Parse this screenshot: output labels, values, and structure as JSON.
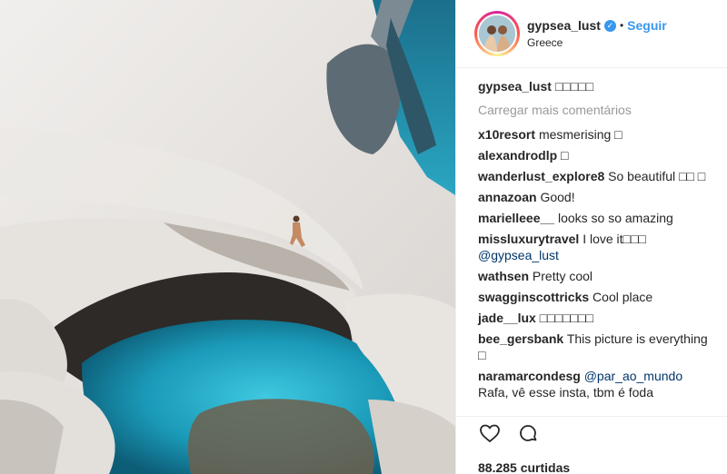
{
  "post": {
    "username": "gypsea_lust",
    "verified_symbol": "✓",
    "separator": "•",
    "follow_label": "Seguir",
    "location": "Greece",
    "likes": "88.285 curtidas"
  },
  "caption": {
    "author": "gypsea_lust",
    "text": "□□□□□"
  },
  "load_more_label": "Carregar mais comentários",
  "comments": [
    {
      "author": "x10resort",
      "text": "mesmerising □",
      "mention": "",
      "suffix": ""
    },
    {
      "author": "alexandrodlp",
      "text": "□",
      "mention": "",
      "suffix": ""
    },
    {
      "author": "wanderlust_explore8",
      "text": "So beautiful □□ □",
      "mention": "",
      "suffix": ""
    },
    {
      "author": "annazoan",
      "text": "Good!",
      "mention": "",
      "suffix": ""
    },
    {
      "author": "marielleee__",
      "text": "looks so so amazing",
      "mention": "",
      "suffix": ""
    },
    {
      "author": "missluxurytravel",
      "text": "I love it□□□ ",
      "mention": "@gypsea_lust",
      "suffix": ""
    },
    {
      "author": "wathsen",
      "text": "Pretty cool",
      "mention": "",
      "suffix": ""
    },
    {
      "author": "swagginscottricks",
      "text": "Cool place",
      "mention": "",
      "suffix": ""
    },
    {
      "author": "jade__lux",
      "text": "□□□□□□□",
      "mention": "",
      "suffix": ""
    },
    {
      "author": "bee_gersbank",
      "text": "This picture is everything □",
      "mention": "",
      "suffix": ""
    },
    {
      "author": "naramarcondesg",
      "text": "",
      "mention": "@par_ao_mundo",
      "suffix": " Rafa, vê esse insta, tbm é foda"
    }
  ],
  "icons": {
    "like": "heart-icon",
    "comment": "comment-icon",
    "avatar": "avatar-photo",
    "verified": "verified-badge"
  },
  "colors": {
    "link": "#3897f0",
    "mention": "#003569",
    "muted": "#999999",
    "text": "#262626",
    "water": "#1fa6c4"
  }
}
